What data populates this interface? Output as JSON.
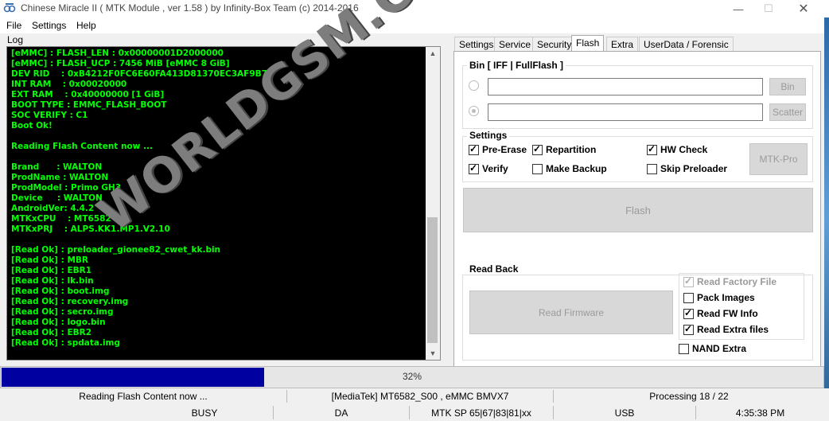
{
  "window": {
    "title": "Chinese Miracle II ( MTK Module , ver 1.58 ) by Infinity-Box Team (c) 2014-2016",
    "minimize_glyph": "—",
    "maximize_glyph": "☐",
    "close_glyph": "✕"
  },
  "menu": {
    "file": "File",
    "settings": "Settings",
    "help": "Help"
  },
  "log": {
    "label": "Log",
    "lines": [
      "[eMMC] : FLASH_LEN : 0x00000001D2000000",
      "[eMMC] : FLASH_UCP : 7456 MiB [eMMC 8 GiB]",
      "DEV RID    : 0xB4212F0FC6E60FA413D81370EC3AF9B7",
      "INT RAM    : 0x00020000",
      "EXT RAM    : 0x40000000 [1 GiB]",
      "BOOT TYPE : EMMC_FLASH_BOOT",
      "SOC VERIFY : C1",
      "Boot Ok!",
      "",
      "Reading Flash Content now ...",
      "",
      "Brand      : WALTON",
      "ProdName : WALTON",
      "ProdModel : Primo GH3",
      "Device     : WALTON",
      "AndroidVer: 4.4.2",
      "MTKxCPU    : MT6582",
      "MTKxPRJ    : ALPS.KK1.MP1.V2.10",
      "",
      "[Read Ok] : preloader_gionee82_cwet_kk.bin",
      "[Read Ok] : MBR",
      "[Read Ok] : EBR1",
      "[Read Ok] : lk.bin",
      "[Read Ok] : boot.img",
      "[Read Ok] : recovery.img",
      "[Read Ok] : secro.img",
      "[Read Ok] : logo.bin",
      "[Read Ok] : EBR2",
      "[Read Ok] : spdata.img"
    ],
    "scroll_up": "▲",
    "scroll_down": "▼"
  },
  "watermark": "WORLDGSM.CLUB",
  "tabs": [
    {
      "label": "Settings",
      "active": false
    },
    {
      "label": "Service",
      "active": false
    },
    {
      "label": "Security",
      "active": false
    },
    {
      "label": "Flash",
      "active": true
    },
    {
      "label": "Extra",
      "active": false
    },
    {
      "label": "UserData / Forensic",
      "active": false
    }
  ],
  "flash": {
    "bin_group_title": "Bin  [ IFF | FullFlash ]",
    "bin_button": "Bin",
    "scatter_button": "Scatter",
    "bin_path": "",
    "scatter_path": "",
    "settings_group_title": "Settings",
    "options": {
      "pre_erase": {
        "label": "Pre-Erase",
        "checked": true
      },
      "repartition": {
        "label": "Repartition",
        "checked": true
      },
      "hw_check": {
        "label": "HW Check",
        "checked": true
      },
      "verify": {
        "label": "Verify",
        "checked": true
      },
      "make_backup": {
        "label": "Make Backup",
        "checked": false
      },
      "skip_preloader": {
        "label": "Skip Preloader",
        "checked": false
      }
    },
    "mtk_pro_button": "MTK-Pro",
    "flash_button": "Flash",
    "read_back_title": "Read Back",
    "read_firmware_button": "Read Firmware",
    "read_options": {
      "read_factory_file": {
        "label": "Read Factory File",
        "checked": true,
        "disabled": true
      },
      "pack_images": {
        "label": "Pack Images",
        "checked": false
      },
      "read_fw_info": {
        "label": "Read FW Info",
        "checked": true
      },
      "read_extra_files": {
        "label": "Read Extra files",
        "checked": true
      }
    },
    "nand_extra": {
      "label": "NAND Extra",
      "checked": false
    }
  },
  "progress": {
    "text": "32%",
    "value": 0.32
  },
  "status": {
    "message": "Reading Flash Content now ...",
    "device": "[MediaTek] MT6582_S00 , eMMC BMVX7",
    "processing": "Processing 18 / 22",
    "state": "BUSY",
    "mode": "DA",
    "port": "MTK SP 65|67|83|81|xx",
    "connection": "USB",
    "time": "4:35:38 PM"
  },
  "colors": {
    "log_background": "#000000",
    "log_text": "#00ff00",
    "progress_fill": "#0000a0",
    "watermark": "#7d7d7d"
  }
}
